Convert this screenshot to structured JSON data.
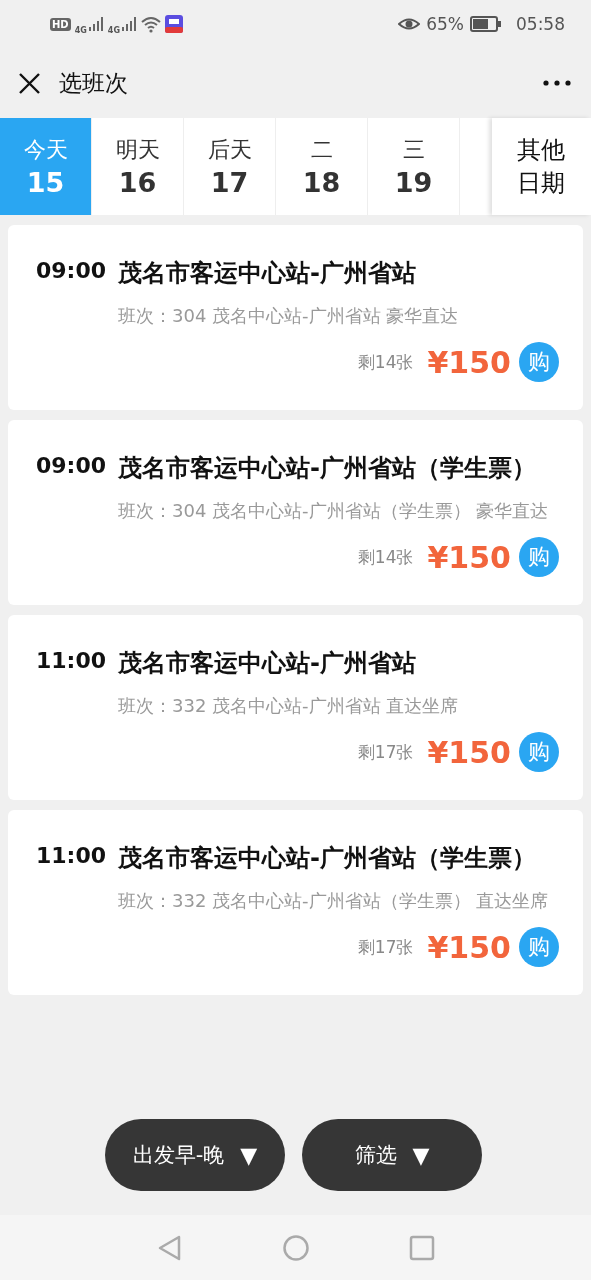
{
  "status_bar": {
    "hd": "HD",
    "network": [
      "4G",
      "4G"
    ],
    "battery_percent": "65%",
    "time": "05:58"
  },
  "header": {
    "title": "选班次"
  },
  "date_tabs": [
    {
      "weekday": "今天",
      "day": "15",
      "selected": true
    },
    {
      "weekday": "明天",
      "day": "16",
      "selected": false
    },
    {
      "weekday": "后天",
      "day": "17",
      "selected": false
    },
    {
      "weekday": "二",
      "day": "18",
      "selected": false
    },
    {
      "weekday": "三",
      "day": "19",
      "selected": false
    }
  ],
  "other_dates": "其他日期",
  "trips": [
    {
      "time": "09:00",
      "route": "茂名市客运中心站-广州省站",
      "detail": "班次：304 茂名中心站-广州省站 豪华直达",
      "remaining": "剩14张",
      "price": "¥150",
      "buy": "购"
    },
    {
      "time": "09:00",
      "route": "茂名市客运中心站-广州省站（学生票）",
      "detail": "班次：304 茂名中心站-广州省站（学生票） 豪华直达",
      "remaining": "剩14张",
      "price": "¥150",
      "buy": "购"
    },
    {
      "time": "11:00",
      "route": "茂名市客运中心站-广州省站",
      "detail": "班次：332 茂名中心站-广州省站 直达坐席",
      "remaining": "剩17张",
      "price": "¥150",
      "buy": "购"
    },
    {
      "time": "11:00",
      "route": "茂名市客运中心站-广州省站（学生票）",
      "detail": "班次：332 茂名中心站-广州省站（学生票） 直达坐席",
      "remaining": "剩17张",
      "price": "¥150",
      "buy": "购"
    }
  ],
  "filters": [
    {
      "label": "出发早-晚",
      "arrow": "▼"
    },
    {
      "label": "筛选",
      "arrow": "▼"
    }
  ]
}
